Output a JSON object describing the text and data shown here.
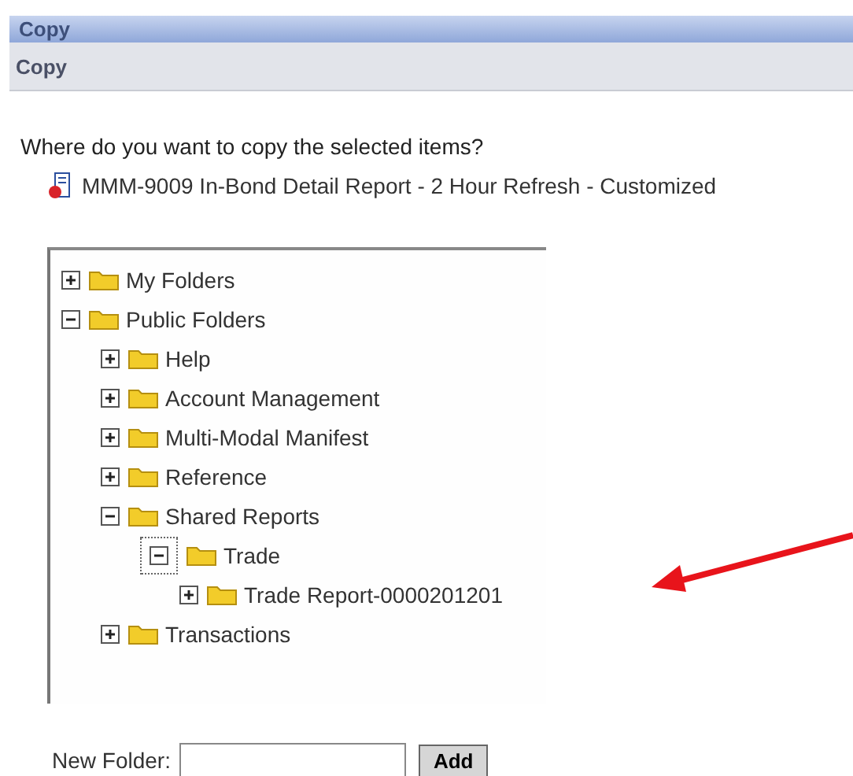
{
  "window": {
    "title": "Copy"
  },
  "header": {
    "title": "Copy"
  },
  "prompt": "Where do you want to copy the selected items?",
  "report": {
    "name": "MMM-9009 In-Bond Detail Report - 2 Hour Refresh - Customized"
  },
  "tree": [
    {
      "label": "My Folders",
      "expanded": false,
      "focused": false
    },
    {
      "label": "Public Folders",
      "expanded": true,
      "focused": false,
      "children": [
        {
          "label": "Help",
          "expanded": false,
          "focused": false
        },
        {
          "label": "Account Management",
          "expanded": false,
          "focused": false
        },
        {
          "label": "Multi-Modal Manifest",
          "expanded": false,
          "focused": false
        },
        {
          "label": "Reference",
          "expanded": false,
          "focused": false
        },
        {
          "label": "Shared Reports",
          "expanded": true,
          "focused": false,
          "children": [
            {
              "label": "Trade",
              "expanded": true,
              "focused": true,
              "children": [
                {
                  "label": "Trade Report-0000201201",
                  "expanded": false,
                  "focused": false
                }
              ]
            }
          ]
        },
        {
          "label": "Transactions",
          "expanded": false,
          "focused": false
        }
      ]
    }
  ],
  "new_folder": {
    "label": "New Folder:",
    "button": "Add"
  }
}
